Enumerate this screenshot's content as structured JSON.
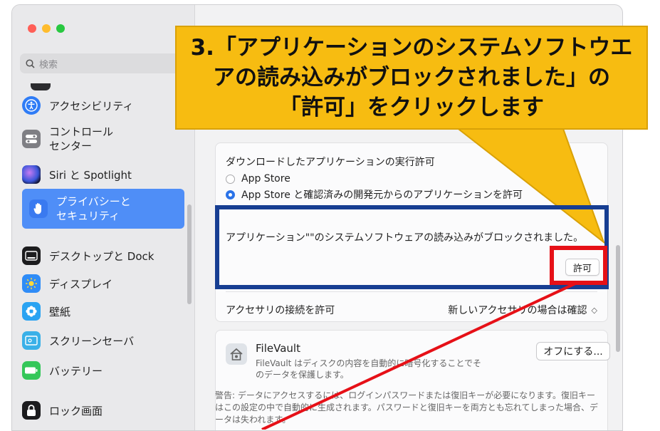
{
  "sidebar": {
    "search_placeholder": "検索",
    "items": [
      {
        "label": "アクセシビリティ",
        "icon": "accessibility-icon"
      },
      {
        "label": "コントロール\nセンター",
        "icon": "control-center-icon"
      },
      {
        "label": "Siri と Spotlight",
        "icon": "siri-icon"
      },
      {
        "label": "プライバシーと\nセキュリティ",
        "icon": "privacy-hand-icon",
        "active": true
      },
      {
        "label": "デスクトップと Dock",
        "icon": "desktop-dock-icon"
      },
      {
        "label": "ディスプレイ",
        "icon": "display-brightness-icon"
      },
      {
        "label": "壁紙",
        "icon": "wallpaper-icon"
      },
      {
        "label": "スクリーンセーバ",
        "icon": "screensaver-icon"
      },
      {
        "label": "バッテリー",
        "icon": "battery-icon"
      },
      {
        "label": "ロック画面",
        "icon": "lock-screen-icon"
      }
    ]
  },
  "security": {
    "download_title": "ダウンロードしたアプリケーションの実行許可",
    "options": [
      "App Store",
      "App Store と確認済みの開発元からのアプリケーションを許可"
    ],
    "selected_option": 1,
    "blocked_message": "アプリケーション\"\"のシステムソフトウェアの読み込みがブロックされました。",
    "allow_button": "許可",
    "accessory_label": "アクセサリの接続を許可",
    "accessory_value": "新しいアクセサリの場合は確認",
    "filevault_title": "FileVault",
    "filevault_desc": "FileVault はディスクの内容を自動的に暗号化することでそのデータを保護します。",
    "filevault_button": "オフにする...",
    "warning": "警告: データにアクセスするには、ログインパスワードまたは復旧キーが必要になります。復旧キーはこの設定の中で自動的に生成されます。パスワードと復旧キーを両方とも忘れてしまった場合、データは失われます。"
  },
  "annotation": {
    "callout_line1": "3.「アプリケーションのシステムソフトウエ",
    "callout_line2": "アの読み込みがブロックされました」の",
    "callout_line3": "「許可」をクリックします"
  },
  "colors": {
    "callout_fill": "#f7bc11",
    "highlight_blue": "#173e92",
    "highlight_red": "#e61017",
    "accent": "#4f8ef7"
  }
}
